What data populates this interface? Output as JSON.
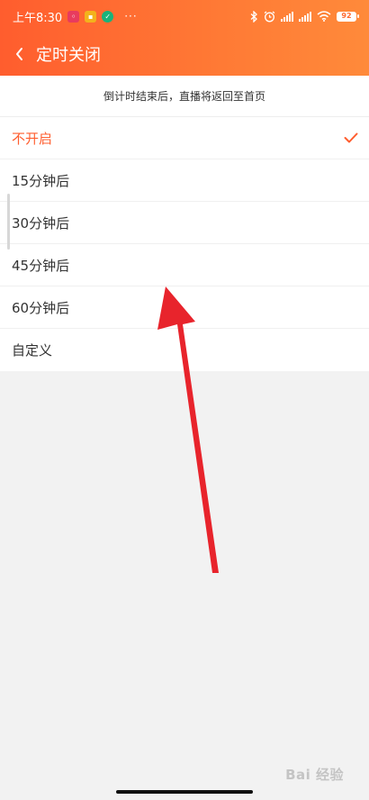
{
  "status_bar": {
    "time": "上午8:30",
    "battery": "92",
    "icons": [
      "notification-app-icon",
      "notification-app-icon",
      "notification-app-icon",
      "bluetooth-icon",
      "alarm-icon",
      "signal-icon",
      "signal-icon",
      "wifi-icon",
      "battery-icon"
    ]
  },
  "nav": {
    "title": "定时关闭",
    "back_icon": "chevron-left-icon"
  },
  "notice": "倒计时结束后，直播将返回至首页",
  "options": [
    {
      "label": "不开启",
      "selected": true
    },
    {
      "label": "15分钟后",
      "selected": false
    },
    {
      "label": "30分钟后",
      "selected": false
    },
    {
      "label": "45分钟后",
      "selected": false
    },
    {
      "label": "60分钟后",
      "selected": false
    },
    {
      "label": "自定义",
      "selected": false
    }
  ],
  "colors": {
    "accent": "#ff5d2e",
    "annotation_arrow": "#e8242c"
  },
  "watermark": "Bai 经验"
}
